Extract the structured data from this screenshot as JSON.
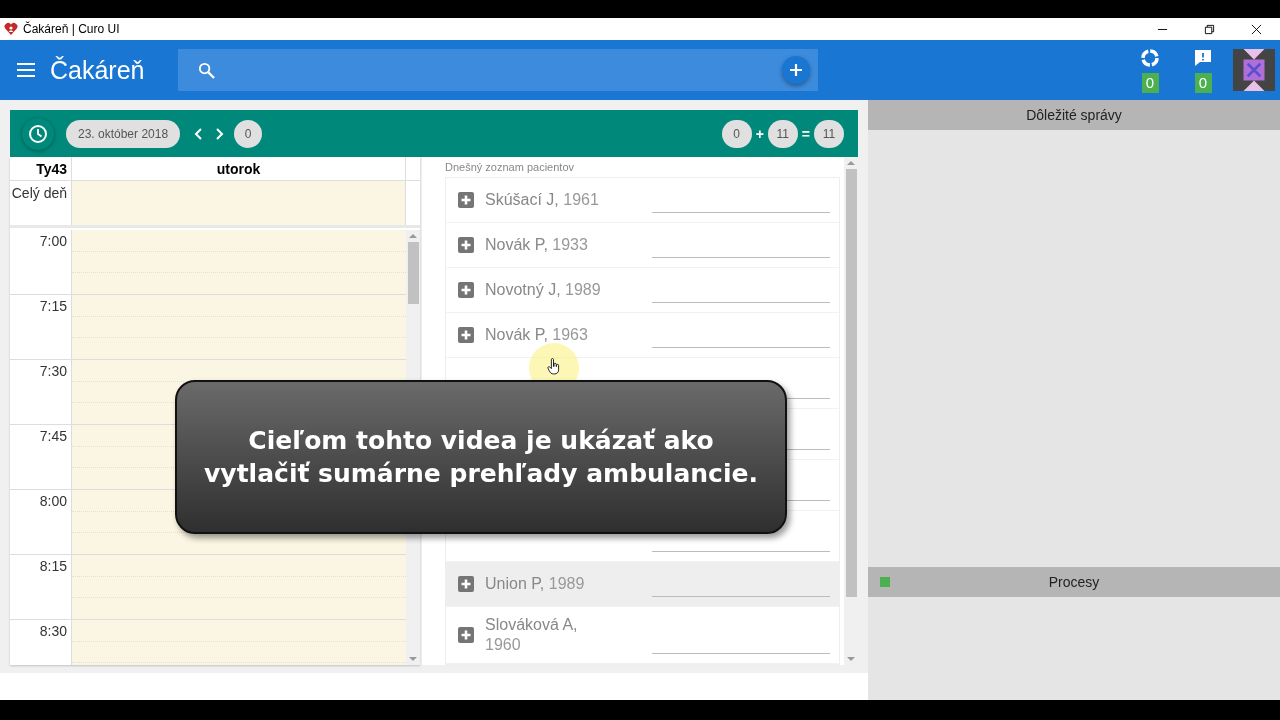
{
  "window": {
    "title": "Čakáreň | Curo UI"
  },
  "app_bar": {
    "title": "Čakáreň",
    "badges": [
      {
        "kind": "sync",
        "count": "0"
      },
      {
        "kind": "messages",
        "count": "0"
      }
    ]
  },
  "toolbar": {
    "date": "23. október 2018",
    "day_count": "0",
    "sum": [
      {
        "kind": "pill",
        "text": "0"
      },
      {
        "kind": "op",
        "text": "+"
      },
      {
        "kind": "pill",
        "text": "11"
      },
      {
        "kind": "op",
        "text": "="
      },
      {
        "kind": "pill",
        "text": "11"
      }
    ]
  },
  "calendar": {
    "week": "Ty43",
    "day": "utorok",
    "all_day": "Celý deň",
    "times": [
      "7:00",
      "7:15",
      "7:30",
      "7:45",
      "8:00",
      "8:15",
      "8:30"
    ]
  },
  "patients": {
    "label": "Dnešný zoznam pacientov",
    "rows": [
      {
        "kind": "patient",
        "name": "Skúšací J,",
        "year": "1961",
        "highlighted": false
      },
      {
        "kind": "patient",
        "name": "Novák P,",
        "year": "1933",
        "highlighted": false
      },
      {
        "kind": "patient",
        "name": "Novotný J,",
        "year": "1989",
        "highlighted": false
      },
      {
        "kind": "patient",
        "name": "Novák P,",
        "year": "1963",
        "highlighted": false
      },
      {
        "kind": "covered"
      },
      {
        "kind": "covered"
      },
      {
        "kind": "covered"
      },
      {
        "kind": "covered"
      },
      {
        "kind": "patient",
        "name": "Union P,",
        "year": "1989",
        "highlighted": true
      },
      {
        "kind": "patient",
        "name": "Slováková A,",
        "year": "1960",
        "highlighted": false
      }
    ]
  },
  "right_panel": {
    "sections": [
      {
        "title": "Dôležité správy"
      },
      {
        "title": "Procesy",
        "color": "#4caf50"
      }
    ]
  },
  "caption": {
    "lines": [
      "Cieľom tohto videa je ukázať ako",
      "vytlačiť sumárne prehľady ambulancie."
    ]
  }
}
